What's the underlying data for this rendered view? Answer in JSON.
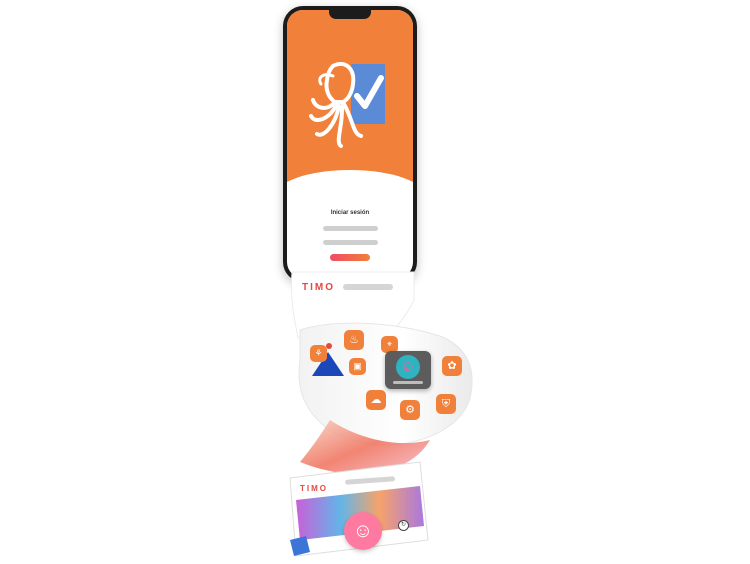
{
  "login": {
    "title": "Iniciar sesión",
    "username_placeholder": "",
    "password_placeholder": "",
    "button_label": "",
    "forgot_link": ""
  },
  "brand": {
    "name": "TIMO",
    "accent_color": "#f0803a",
    "brand_red": "#e24a3f",
    "check_blue": "#5b8ad6"
  },
  "icons": [
    {
      "name": "thermometer-icon",
      "glyph": "♨"
    },
    {
      "name": "location-icon",
      "glyph": "⌖"
    },
    {
      "name": "map-pin-icon",
      "glyph": "⊙"
    },
    {
      "name": "plant-icon",
      "glyph": "⚘"
    },
    {
      "name": "camera-icon",
      "glyph": "▣"
    },
    {
      "name": "cloud-icon",
      "glyph": "☁"
    },
    {
      "name": "settings-icon",
      "glyph": "⚙"
    },
    {
      "name": "shield-icon",
      "glyph": "⛨"
    },
    {
      "name": "flowers-icon",
      "glyph": "✿"
    }
  ],
  "avatar": {
    "glyph": "☺"
  },
  "bottom_avatar": {
    "glyph": "☺"
  },
  "controls": {
    "refresh": "↻",
    "close": "×"
  }
}
